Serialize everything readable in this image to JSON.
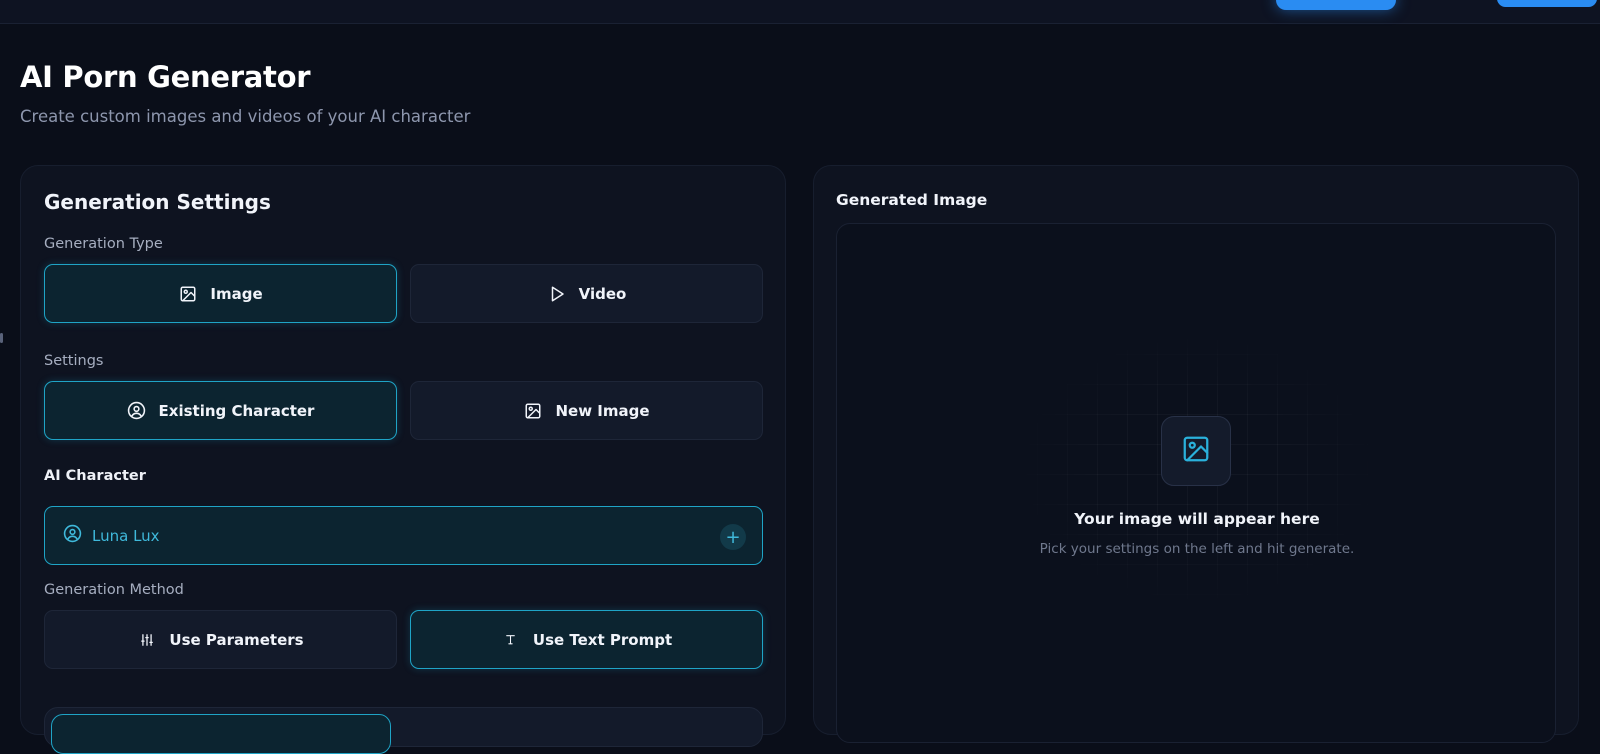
{
  "header": {
    "title": "AI Porn Generator",
    "subtitle": "Create custom images and videos of your AI character"
  },
  "settings": {
    "title": "Generation Settings",
    "generation_type": {
      "label": "Generation Type",
      "options": [
        {
          "label": "Image",
          "icon": "image-icon",
          "selected": true
        },
        {
          "label": "Video",
          "icon": "play-icon",
          "selected": false
        }
      ]
    },
    "settings_mode": {
      "label": "Settings",
      "options": [
        {
          "label": "Existing Character",
          "icon": "user-circle-icon",
          "selected": true
        },
        {
          "label": "New Image",
          "icon": "image-icon",
          "selected": false
        }
      ]
    },
    "character": {
      "label": "AI Character",
      "value": "Luna Lux",
      "add_symbol": "+"
    },
    "method": {
      "label": "Generation Method",
      "options": [
        {
          "label": "Use Parameters",
          "icon": "sliders-icon",
          "selected": false
        },
        {
          "label": "Use Text Prompt",
          "icon": "text-icon",
          "selected": true
        }
      ]
    }
  },
  "result": {
    "title": "Generated Image",
    "placeholder_heading": "Your image will appear here",
    "placeholder_hint": "Pick your settings on the left and hit generate."
  },
  "colors": {
    "background": "#0a0e19",
    "accent": "#1fa4c6",
    "brand_blue": "#2a8cf2"
  }
}
